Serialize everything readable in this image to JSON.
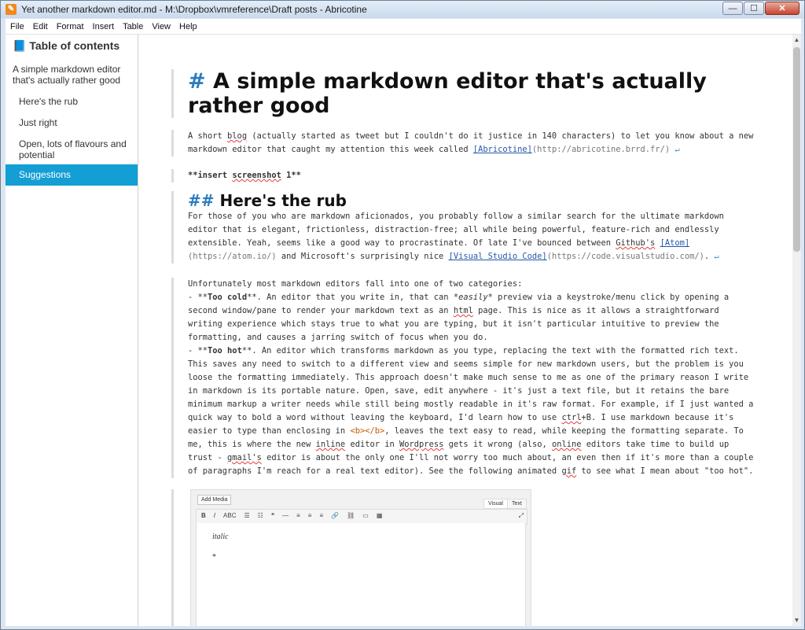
{
  "window": {
    "title": "Yet another markdown editor.md - M:\\Dropbox\\vmreference\\Draft posts - Abricotine",
    "app_icon": "abricotine-icon",
    "controls": {
      "minimize": "—",
      "maximize": "☐",
      "close": "✕"
    }
  },
  "menu": [
    "File",
    "Edit",
    "Format",
    "Insert",
    "Table",
    "View",
    "Help"
  ],
  "sidebar": {
    "title_icon": "📘",
    "title": "Table of contents",
    "items": [
      {
        "label": "A simple markdown editor that's actually rather good",
        "active": false,
        "level": 1
      },
      {
        "label": "Here's the rub",
        "active": false,
        "level": 2
      },
      {
        "label": "Just right",
        "active": false,
        "level": 2
      },
      {
        "label": "Open, lots of flavours and potential",
        "active": false,
        "level": 2
      },
      {
        "label": "Suggestions",
        "active": true,
        "level": 2
      }
    ]
  },
  "document": {
    "h1_hash": "#",
    "h1_text": "A simple markdown editor that's actually rather good",
    "p1_a": "A short ",
    "p1_blog": "blog",
    "p1_b": " (actually started as tweet but I couldn't do it justice in 140 characters) to let you know about a new markdown editor that caught my attention this week called ",
    "p1_link": "[Abricotine]",
    "p1_url": "(http://abricotine.brrd.fr/)",
    "return_glyph": "↵",
    "p2_open": "**",
    "p2_insert": "insert",
    "p2_space": " ",
    "p2_screenshot": "screenshot",
    "p2_rest": " 1",
    "p2_close": "**",
    "h2_hash": "##",
    "h2_text": "Here's the rub",
    "p3_a": "For those of you who are markdown aficionados, you probably follow a similar search for the ultimate markdown editor that is elegant, frictionless, distraction-free; all while being powerful, feature-rich and endlessly extensible. Yeah, seems like a good way to procrastinate.  Of late I've bounced between ",
    "p3_github": "Github's",
    "p3_space": " ",
    "p3_link1": "[Atom]",
    "p3_url1": "(https://atom.io/)",
    "p3_b": " and Microsoft's surprisingly nice ",
    "p3_link2": "[Visual Studio Code]",
    "p3_url2": "(https://code.visualstudio.com/)",
    "p3_end": ".",
    "p4_intro": "Unfortunately most markdown editors fall into one of two categories:",
    "p4_b1_dash": "- ",
    "p4_b1_open": "**",
    "p4_b1_bold": "Too cold",
    "p4_b1_close": "**",
    "p4_b1_a": ". An editor that you write in, that can ",
    "p4_b1_star1": "*",
    "p4_b1_easily": "easily",
    "p4_b1_star2": "*",
    "p4_b1_b": " preview via a keystroke/menu click by opening a second window/pane to render your markdown text as an ",
    "p4_b1_html": "html",
    "p4_b1_c": " page.  This is nice as it allows a straightforward writing experience which stays true to what you are typing, but it isn't particular intuitive to preview the formatting, and causes a jarring switch of focus when you do.",
    "p4_b2_dash": "- ",
    "p4_b2_open": "**",
    "p4_b2_bold": "Too hot",
    "p4_b2_close": "**",
    "p4_b2_a": ". An editor which transforms markdown as you type, replacing the text with the formatted rich text. This saves any need to switch to a different view and seems simple for new markdown users, but the problem is you loose the formatting immediately. This approach doesn't make much sense to me as one of the primary reason I write in markdown is its portable nature. Open, save, edit anywhere - it's just a text file, but it retains the bare minimum markup a writer needs while still being mostly readable in it's raw format. For example, if I just wanted a quick way to bold a word without leaving the keyboard, I'd learn how to use ",
    "p4_b2_ctrl": "ctrl",
    "p4_b2_b": "+B. I use markdown because it's easier to type than enclosing in ",
    "p4_b2_tag": "<b></b>",
    "p4_b2_c": ", leaves the text easy to read, while keeping the formatting separate.  To me, this is where the new ",
    "p4_b2_inline": "inline",
    "p4_b2_d": " editor in ",
    "p4_b2_wordpress": "Wordpress",
    "p4_b2_e": " gets it wrong (also, ",
    "p4_b2_online": "online",
    "p4_b2_f": " editors take time to build up trust - ",
    "p4_b2_gmail": "gmail's",
    "p4_b2_g": " editor is about the only one I'll not worry too much about, an even then if it's more than a couple of paragraphs I'm reach for a real text editor).  See the following animated ",
    "p4_b2_gif": "gif",
    "p4_b2_h": " to see what I mean about \"too hot\"."
  },
  "embedded_image": {
    "add_media": "Add Media",
    "tab_visual": "Visual",
    "tab_text": "Text",
    "toolbar": [
      "B",
      "I",
      "ABC",
      "☰",
      "☷",
      "❝",
      "—",
      "≡",
      "≡",
      "≡",
      "🔗",
      "⛓",
      "▭",
      "▦"
    ],
    "fullscreen": "⤢",
    "line1": "italic",
    "line2": "*"
  }
}
